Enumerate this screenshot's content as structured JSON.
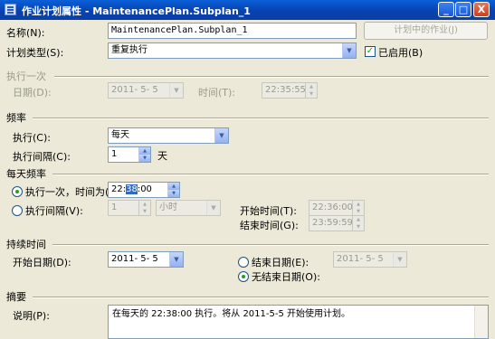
{
  "window": {
    "title": "作业计划属性 - MaintenancePlan.Subplan_1",
    "min_symbol": "_",
    "max_symbol": "□",
    "close_symbol": "X"
  },
  "general": {
    "name_label": "名称(N):",
    "name_value": "MaintenancePlan.Subplan_1",
    "jobs_button": "计划中的作业(J)",
    "schedule_type_label": "计划类型(S):",
    "schedule_type_value": "重复执行",
    "enabled_label": "已启用(B)",
    "enabled_mark": "✓"
  },
  "one_time": {
    "header": "执行一次",
    "date_label": "日期(D):",
    "date_value": "2011- 5- 5",
    "time_label": "时间(T):",
    "time_value": "22:35:55"
  },
  "frequency": {
    "header": "频率",
    "occurs_label": "执行(C):",
    "occurs_value": "每天",
    "recurs_label": "执行间隔(C):",
    "recurs_value": "1",
    "recurs_unit": "天"
  },
  "daily": {
    "header": "每天频率",
    "once_label": "执行一次，时间为(A):",
    "once_time_hh": "22:",
    "once_time_mm": "38",
    "once_time_ss": ":00",
    "every_label": "执行间隔(V):",
    "every_value": "1",
    "every_unit": "小时",
    "start_label": "开始时间(T):",
    "start_value": "22:36:00",
    "end_label": "结束时间(G):",
    "end_value": "23:59:59"
  },
  "duration": {
    "header": "持续时间",
    "start_date_label": "开始日期(D):",
    "start_date_value": "2011- 5- 5",
    "end_date_label": "结束日期(E):",
    "end_date_value": "2011- 5- 5",
    "no_end_label": "无结束日期(O):"
  },
  "summary": {
    "header": "摘要",
    "desc_label": "说明(P):",
    "desc_value": "在每天的 22:38:00 执行。将从 2011-5-5 开始使用计划。"
  }
}
